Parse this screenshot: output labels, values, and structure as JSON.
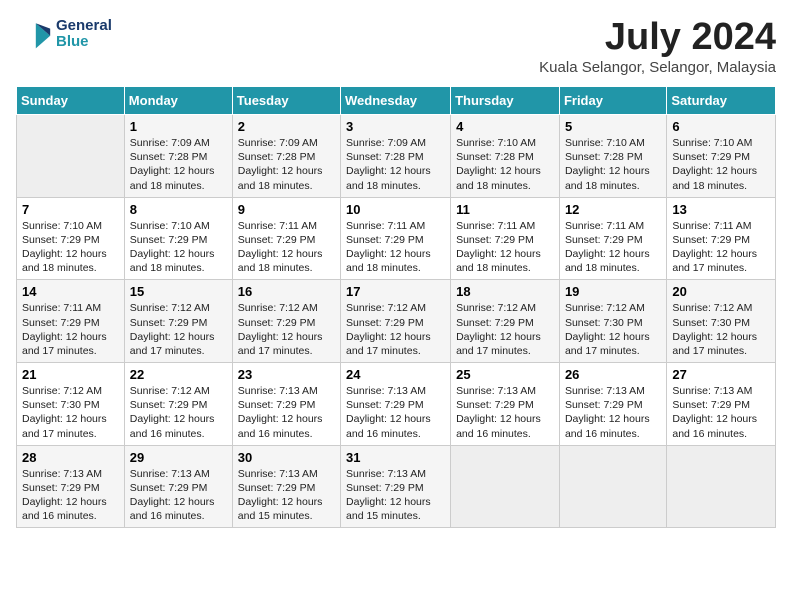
{
  "header": {
    "logo_line1": "General",
    "logo_line2": "Blue",
    "month_title": "July 2024",
    "subtitle": "Kuala Selangor, Selangor, Malaysia"
  },
  "weekdays": [
    "Sunday",
    "Monday",
    "Tuesday",
    "Wednesday",
    "Thursday",
    "Friday",
    "Saturday"
  ],
  "weeks": [
    [
      {
        "day": "",
        "empty": true
      },
      {
        "day": "1",
        "sunrise": "7:09 AM",
        "sunset": "7:28 PM",
        "daylight": "12 hours and 18 minutes."
      },
      {
        "day": "2",
        "sunrise": "7:09 AM",
        "sunset": "7:28 PM",
        "daylight": "12 hours and 18 minutes."
      },
      {
        "day": "3",
        "sunrise": "7:09 AM",
        "sunset": "7:28 PM",
        "daylight": "12 hours and 18 minutes."
      },
      {
        "day": "4",
        "sunrise": "7:10 AM",
        "sunset": "7:28 PM",
        "daylight": "12 hours and 18 minutes."
      },
      {
        "day": "5",
        "sunrise": "7:10 AM",
        "sunset": "7:28 PM",
        "daylight": "12 hours and 18 minutes."
      },
      {
        "day": "6",
        "sunrise": "7:10 AM",
        "sunset": "7:29 PM",
        "daylight": "12 hours and 18 minutes."
      }
    ],
    [
      {
        "day": "7",
        "sunrise": "7:10 AM",
        "sunset": "7:29 PM",
        "daylight": "12 hours and 18 minutes."
      },
      {
        "day": "8",
        "sunrise": "7:10 AM",
        "sunset": "7:29 PM",
        "daylight": "12 hours and 18 minutes."
      },
      {
        "day": "9",
        "sunrise": "7:11 AM",
        "sunset": "7:29 PM",
        "daylight": "12 hours and 18 minutes."
      },
      {
        "day": "10",
        "sunrise": "7:11 AM",
        "sunset": "7:29 PM",
        "daylight": "12 hours and 18 minutes."
      },
      {
        "day": "11",
        "sunrise": "7:11 AM",
        "sunset": "7:29 PM",
        "daylight": "12 hours and 18 minutes."
      },
      {
        "day": "12",
        "sunrise": "7:11 AM",
        "sunset": "7:29 PM",
        "daylight": "12 hours and 18 minutes."
      },
      {
        "day": "13",
        "sunrise": "7:11 AM",
        "sunset": "7:29 PM",
        "daylight": "12 hours and 17 minutes."
      }
    ],
    [
      {
        "day": "14",
        "sunrise": "7:11 AM",
        "sunset": "7:29 PM",
        "daylight": "12 hours and 17 minutes."
      },
      {
        "day": "15",
        "sunrise": "7:12 AM",
        "sunset": "7:29 PM",
        "daylight": "12 hours and 17 minutes."
      },
      {
        "day": "16",
        "sunrise": "7:12 AM",
        "sunset": "7:29 PM",
        "daylight": "12 hours and 17 minutes."
      },
      {
        "day": "17",
        "sunrise": "7:12 AM",
        "sunset": "7:29 PM",
        "daylight": "12 hours and 17 minutes."
      },
      {
        "day": "18",
        "sunrise": "7:12 AM",
        "sunset": "7:29 PM",
        "daylight": "12 hours and 17 minutes."
      },
      {
        "day": "19",
        "sunrise": "7:12 AM",
        "sunset": "7:30 PM",
        "daylight": "12 hours and 17 minutes."
      },
      {
        "day": "20",
        "sunrise": "7:12 AM",
        "sunset": "7:30 PM",
        "daylight": "12 hours and 17 minutes."
      }
    ],
    [
      {
        "day": "21",
        "sunrise": "7:12 AM",
        "sunset": "7:30 PM",
        "daylight": "12 hours and 17 minutes."
      },
      {
        "day": "22",
        "sunrise": "7:12 AM",
        "sunset": "7:29 PM",
        "daylight": "12 hours and 16 minutes."
      },
      {
        "day": "23",
        "sunrise": "7:13 AM",
        "sunset": "7:29 PM",
        "daylight": "12 hours and 16 minutes."
      },
      {
        "day": "24",
        "sunrise": "7:13 AM",
        "sunset": "7:29 PM",
        "daylight": "12 hours and 16 minutes."
      },
      {
        "day": "25",
        "sunrise": "7:13 AM",
        "sunset": "7:29 PM",
        "daylight": "12 hours and 16 minutes."
      },
      {
        "day": "26",
        "sunrise": "7:13 AM",
        "sunset": "7:29 PM",
        "daylight": "12 hours and 16 minutes."
      },
      {
        "day": "27",
        "sunrise": "7:13 AM",
        "sunset": "7:29 PM",
        "daylight": "12 hours and 16 minutes."
      }
    ],
    [
      {
        "day": "28",
        "sunrise": "7:13 AM",
        "sunset": "7:29 PM",
        "daylight": "12 hours and 16 minutes."
      },
      {
        "day": "29",
        "sunrise": "7:13 AM",
        "sunset": "7:29 PM",
        "daylight": "12 hours and 16 minutes."
      },
      {
        "day": "30",
        "sunrise": "7:13 AM",
        "sunset": "7:29 PM",
        "daylight": "12 hours and 15 minutes."
      },
      {
        "day": "31",
        "sunrise": "7:13 AM",
        "sunset": "7:29 PM",
        "daylight": "12 hours and 15 minutes."
      },
      {
        "day": "",
        "empty": true
      },
      {
        "day": "",
        "empty": true
      },
      {
        "day": "",
        "empty": true
      }
    ]
  ]
}
